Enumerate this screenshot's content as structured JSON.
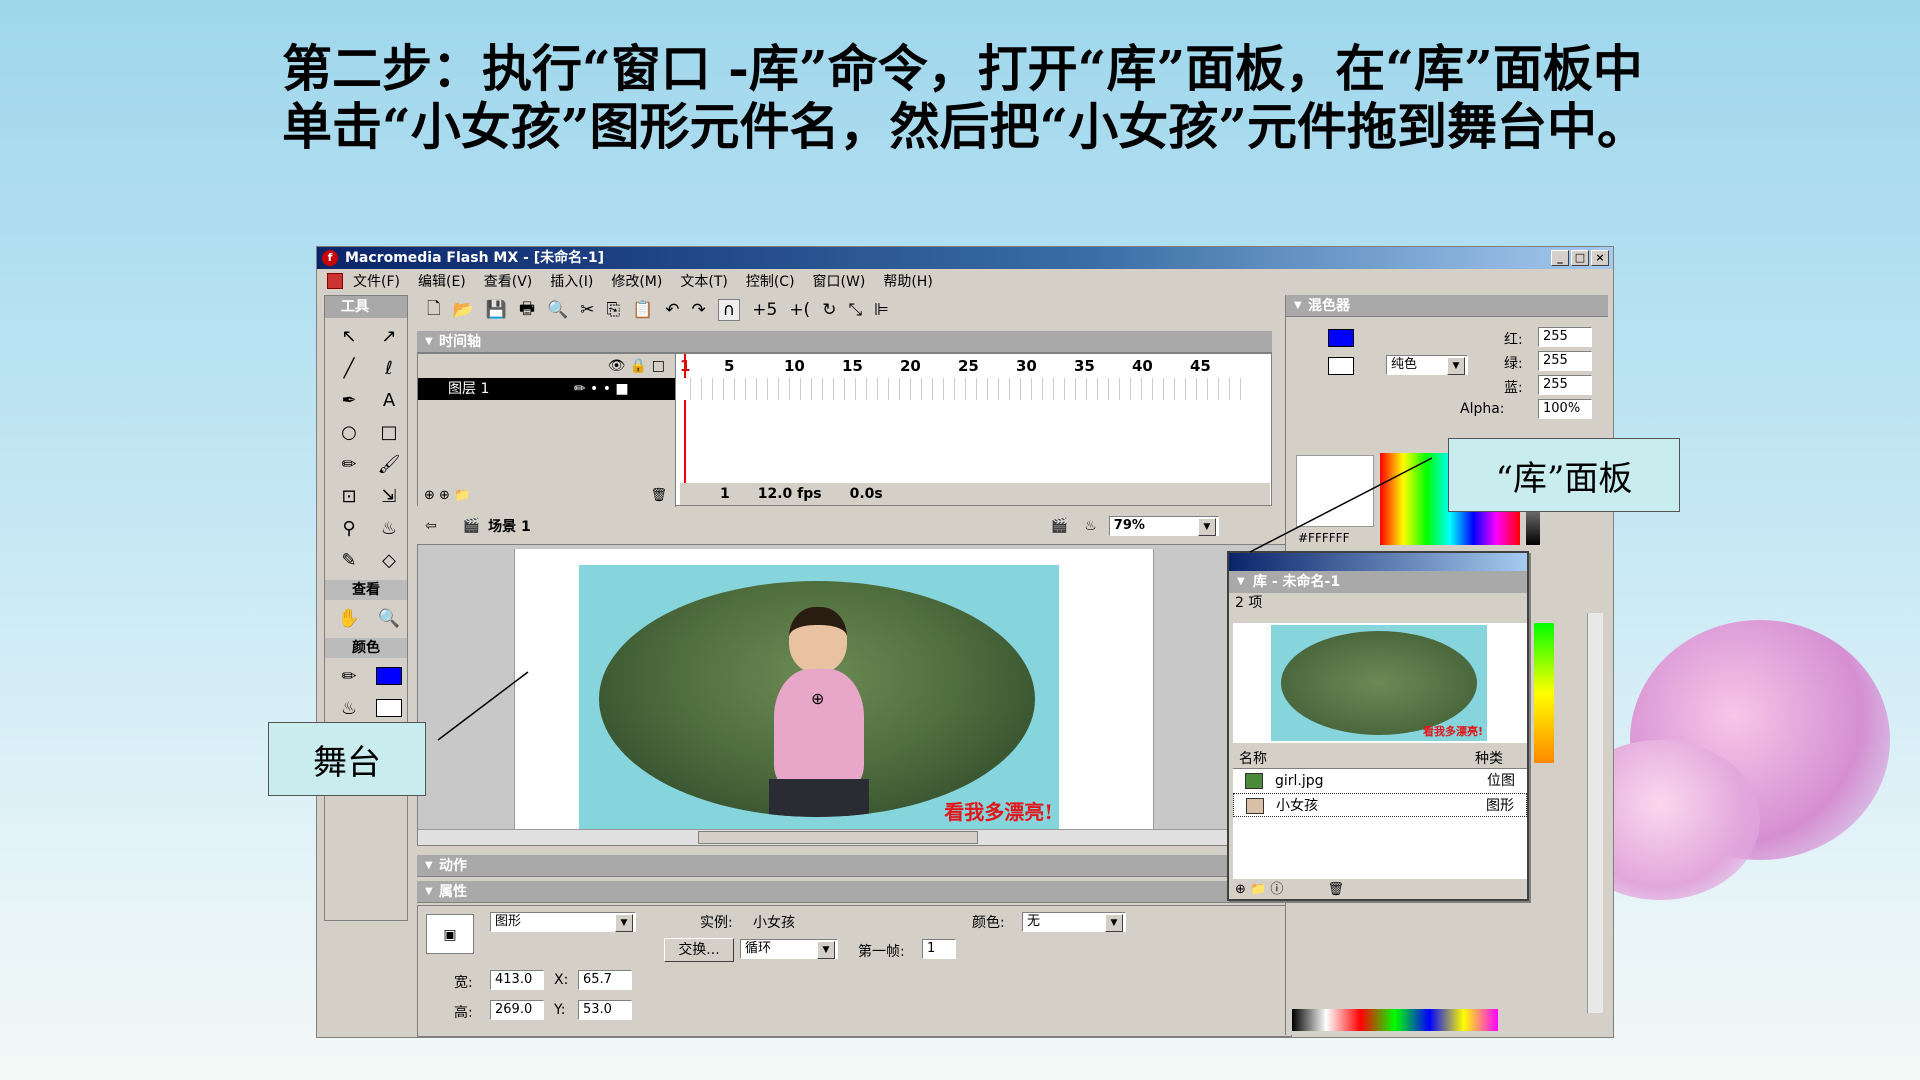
{
  "slide": {
    "step_text": "第二步：执行“窗口 -库”命令，打开“库”面板，在“库”面板中单击“小女孩”图形元件名，然后把“小女孩”元件拖到舞台中。"
  },
  "window": {
    "title": "Macromedia Flash MX - [未命名-1]",
    "minimize": "_",
    "maximize": "□",
    "close": "×"
  },
  "menu": [
    "文件(F)",
    "编辑(E)",
    "查看(V)",
    "插入(I)",
    "修改(M)",
    "文本(T)",
    "控制(C)",
    "窗口(W)",
    "帮助(H)"
  ],
  "tools_panel": {
    "title": "工具",
    "view_label": "查看",
    "color_label": "颜色",
    "tools": [
      "↖",
      "↗",
      "╱",
      "ℓ",
      "✒",
      "A",
      "○",
      "□",
      "✏",
      "🖌",
      "⊡",
      "⇲",
      "⚲",
      "♨",
      "✎",
      "◇"
    ],
    "view_tools": [
      "✋",
      "🔍"
    ]
  },
  "timeline": {
    "title": "时间轴",
    "layer_name": "图层 1",
    "frame_marks": [
      "1",
      "5",
      "10",
      "15",
      "20",
      "25",
      "30",
      "35",
      "40",
      "45"
    ],
    "current_frame": "1",
    "fps": "12.0 fps",
    "time": "0.0s"
  },
  "scene": {
    "name": "场景 1",
    "zoom": "79%"
  },
  "stage": {
    "photo_caption": "看我多漂亮!"
  },
  "panels": {
    "actions": "动作",
    "properties": "属性"
  },
  "properties": {
    "type": "图形",
    "instance_label": "实例:",
    "instance_name": "小女孩",
    "swap_button": "交换...",
    "loop_option": "循环",
    "first_frame_label": "第一帧:",
    "first_frame": "1",
    "color_label": "颜色:",
    "color_value": "无",
    "width_label": "宽:",
    "width": "413.0",
    "height_label": "高:",
    "height": "269.0",
    "x_label": "X:",
    "x": "65.7",
    "y_label": "Y:",
    "y": "53.0"
  },
  "mixer": {
    "title": "混色器",
    "fill_type": "纯色",
    "red_label": "红:",
    "red": "255",
    "green_label": "绿:",
    "green": "255",
    "blue_label": "蓝:",
    "blue": "255",
    "alpha_label": "Alpha:",
    "alpha": "100%",
    "hex": "#FFFFFF"
  },
  "library": {
    "title": "库 - 未命名-1",
    "count": "2 项",
    "col_name": "名称",
    "col_kind": "种类",
    "items": [
      {
        "name": "girl.jpg",
        "kind": "位图"
      },
      {
        "name": "小女孩",
        "kind": "图形"
      }
    ],
    "preview_caption": "看我多漂亮!"
  },
  "callouts": {
    "library_panel": "“库”面板",
    "stage": "舞台"
  }
}
